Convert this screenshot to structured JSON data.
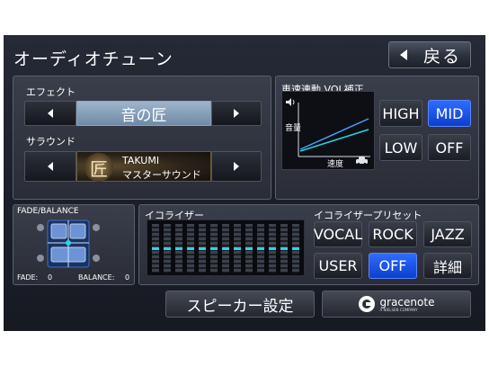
{
  "header": {
    "title": "オーディオチューン",
    "back_label": "戻る"
  },
  "effect": {
    "label": "エフェクト",
    "value": "音の匠"
  },
  "surround": {
    "label": "サラウンド",
    "logo_glyph": "匠",
    "value_line1": "TAKUMI",
    "value_line2": "マスターサウンド"
  },
  "vol_correction": {
    "title": "車速連動 VOL補正",
    "graph_ylabel": "音量",
    "graph_xlabel": "速度",
    "buttons": [
      {
        "label": "HIGH",
        "active": false
      },
      {
        "label": "MID",
        "active": true
      },
      {
        "label": "LOW",
        "active": false
      },
      {
        "label": "OFF",
        "active": false
      }
    ]
  },
  "fade_balance": {
    "title": "FADE/BALANCE",
    "fade_label": "FADE:",
    "fade_value": "0",
    "balance_label": "BALANCE:",
    "balance_value": "0"
  },
  "equalizer": {
    "title": "イコライザー",
    "bands": 13,
    "levels": [
      0,
      0,
      0,
      0,
      0,
      0,
      0,
      0,
      0,
      0,
      0,
      0,
      0
    ]
  },
  "eq_preset": {
    "title": "イコライザープリセット",
    "buttons": [
      {
        "label": "VOCAL",
        "active": false
      },
      {
        "label": "ROCK",
        "active": false
      },
      {
        "label": "JAZZ",
        "active": false
      },
      {
        "label": "USER",
        "active": false
      },
      {
        "label": "OFF",
        "active": true
      },
      {
        "label": "詳細",
        "active": false
      }
    ]
  },
  "footer": {
    "speaker_label": "スピーカー設定",
    "gracenote_label": "gracenote",
    "gracenote_sub": "A NIELSEN COMPANY"
  },
  "colors": {
    "accent_blue": "#1f55f0",
    "eq_cyan": "#29d4e6",
    "selector_blue": "#7f99b5"
  }
}
